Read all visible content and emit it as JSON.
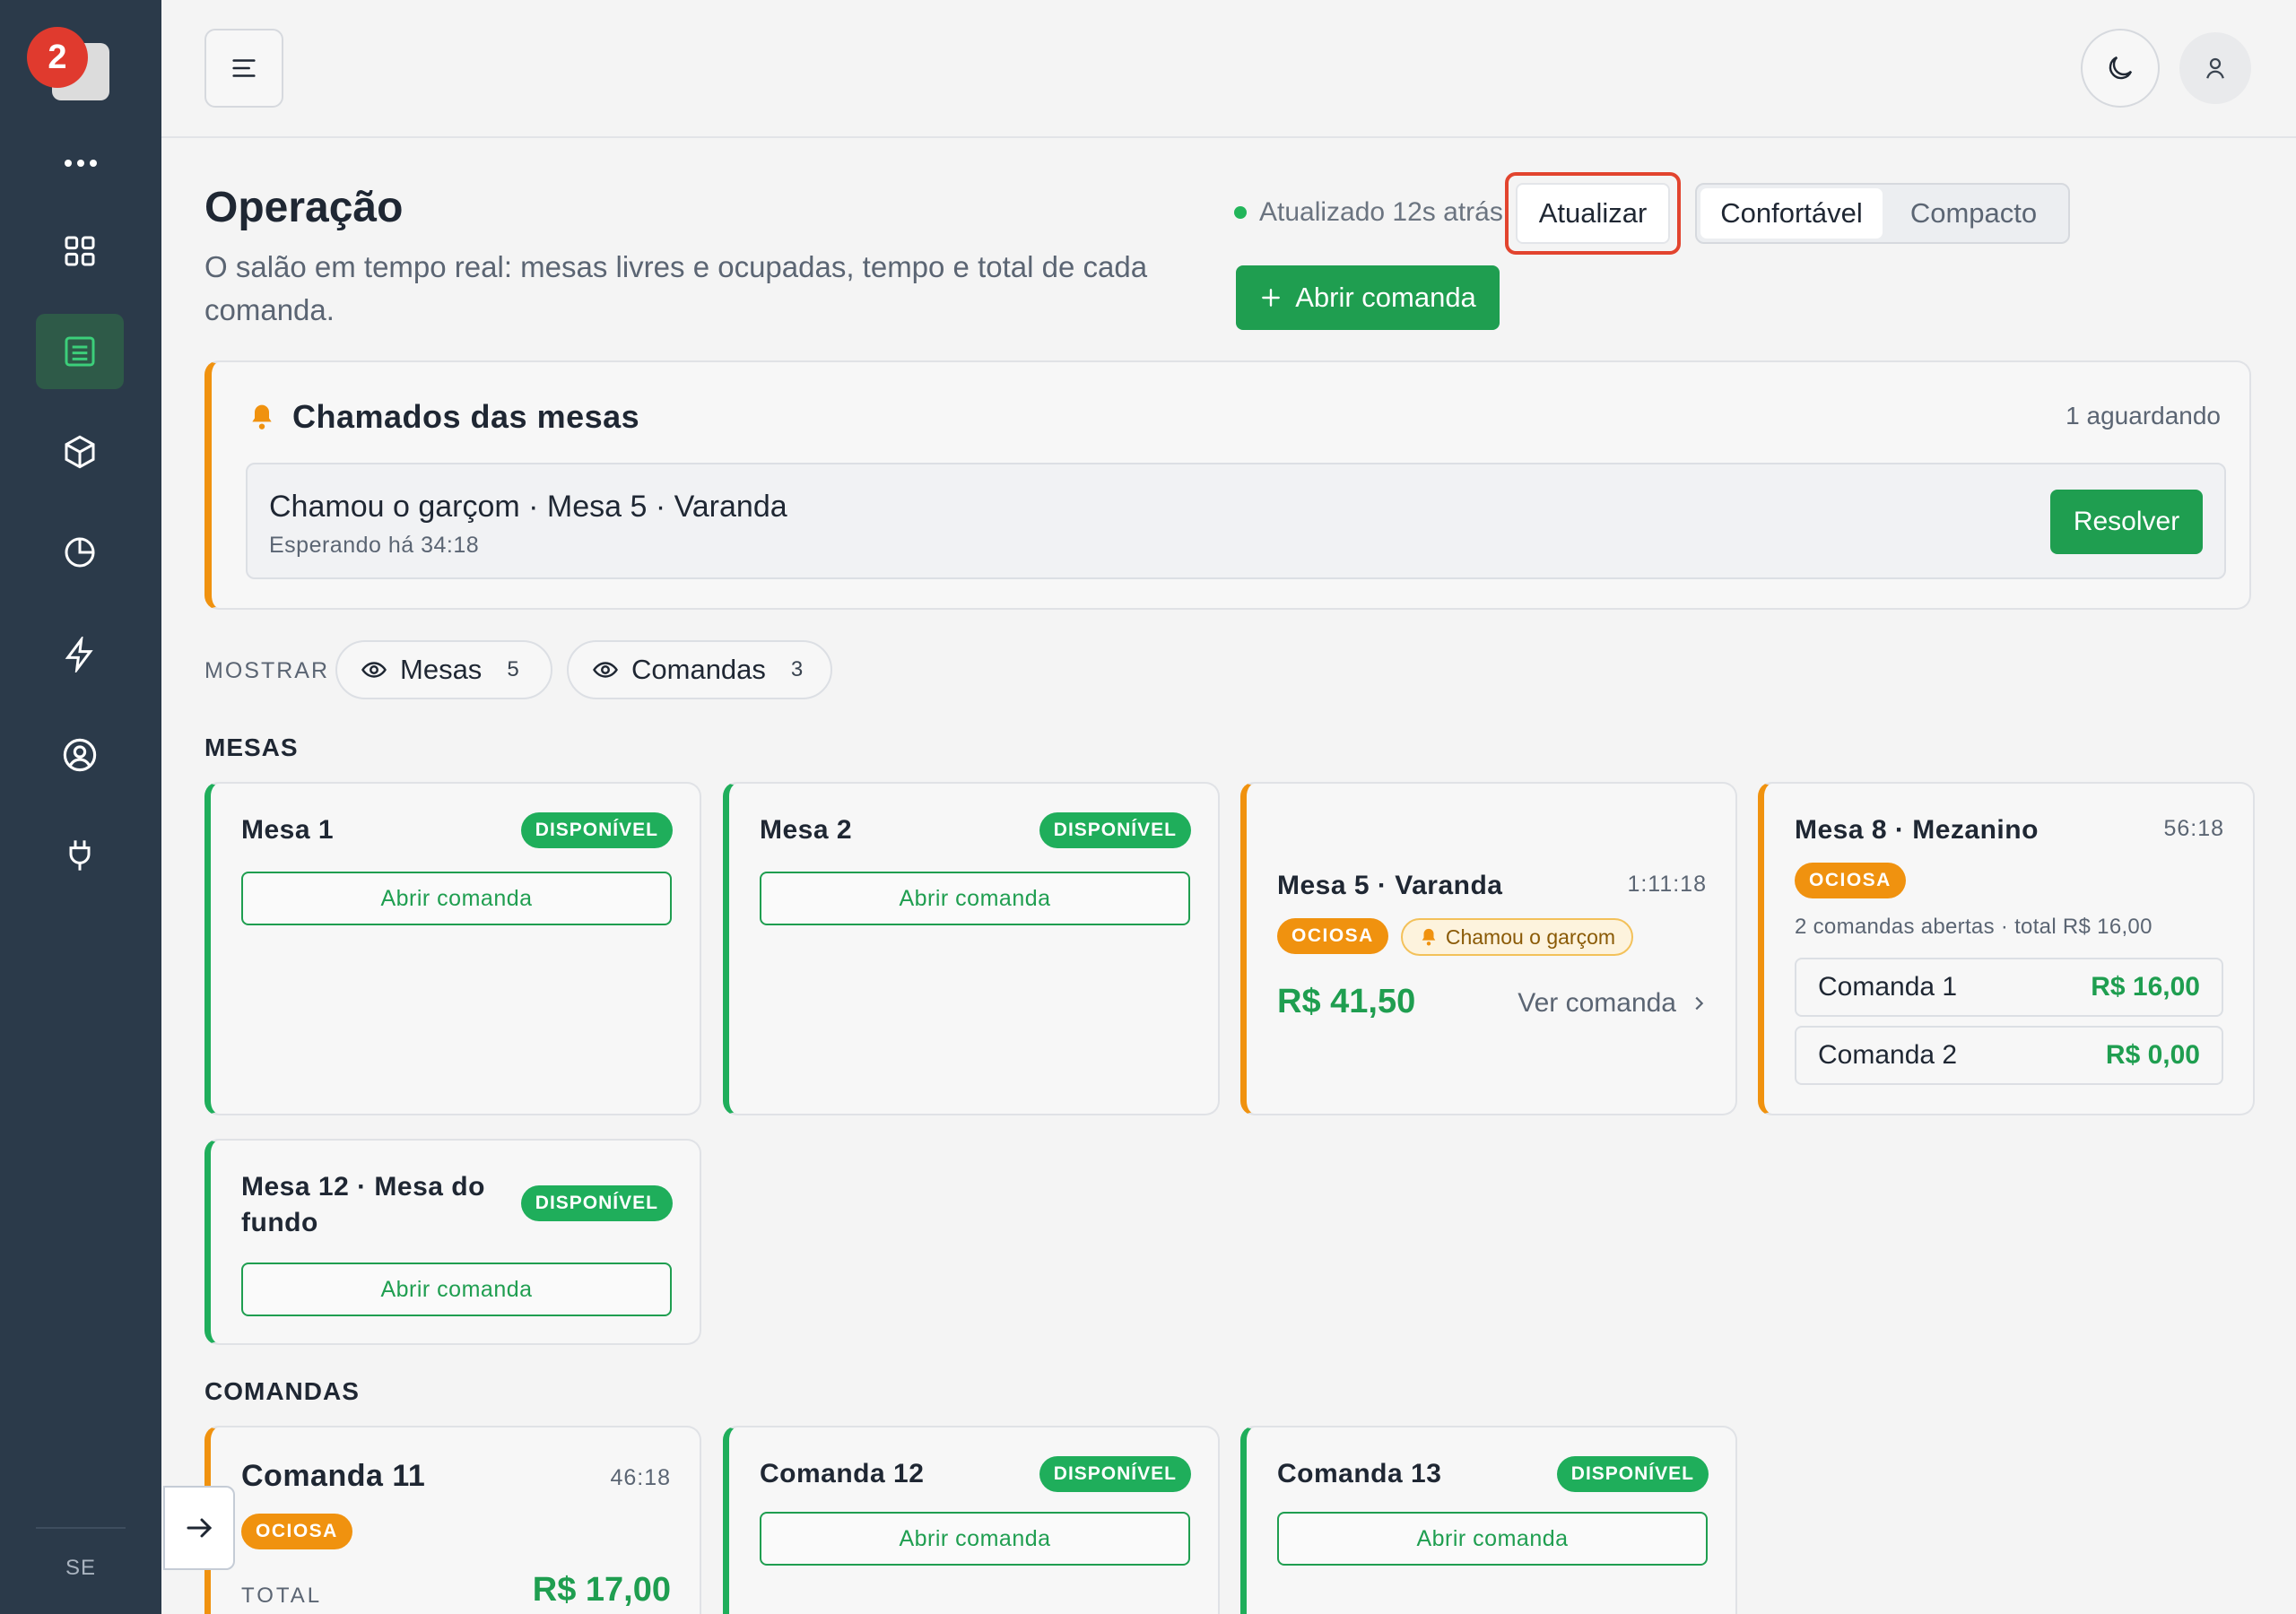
{
  "sidebar": {
    "badge_count": "2",
    "footer_label": "SE",
    "nav": [
      "dashboard-icon",
      "orders-icon",
      "box-icon",
      "pie-chart-icon",
      "bolt-icon",
      "user-circle-icon",
      "plug-icon"
    ],
    "active_color": "#2e5a48"
  },
  "header": {
    "title": "Operação",
    "subtitle": "O salão em tempo real: mesas livres e ocupadas, tempo e total de cada comanda.",
    "status": "Atualizado 12s atrás",
    "refresh_label": "Atualizar",
    "density": [
      "Confortável",
      "Compacto"
    ],
    "open_label": "Abrir comanda"
  },
  "calls": {
    "title": "Chamados das mesas",
    "count": "1 aguardando",
    "item_title": "Chamou o garçom · Mesa 5 · Varanda",
    "item_wait": "Esperando há 34:18",
    "resolve_label": "Resolver"
  },
  "filters": {
    "label": "MOSTRAR",
    "mesas_label": "Mesas",
    "mesas_count": "5",
    "comandas_label": "Comandas",
    "comandas_count": "3"
  },
  "mesas": {
    "title": "MESAS",
    "m1": {
      "name": "Mesa 1",
      "status": "DISPONÍVEL",
      "action": "Abrir comanda"
    },
    "m2": {
      "name": "Mesa 2",
      "status": "DISPONÍVEL",
      "action": "Abrir comanda"
    },
    "m5": {
      "name": "Mesa 5 · Varanda",
      "time": "1:11:18",
      "status": "OCIOSA",
      "call": "Chamou o garçom",
      "total": "R$ 41,50",
      "view": "Ver comanda"
    },
    "m8": {
      "name": "Mesa 8 · Mezanino",
      "time": "56:18",
      "status": "OCIOSA",
      "summary": "2 comandas abertas · total R$ 16,00",
      "rows": [
        {
          "label": "Comanda 1",
          "value": "R$ 16,00"
        },
        {
          "label": "Comanda 2",
          "value": "R$ 0,00"
        }
      ]
    },
    "m12": {
      "name": "Mesa 12 · Mesa do fundo",
      "status": "DISPONÍVEL",
      "action": "Abrir comanda"
    }
  },
  "comandas": {
    "title": "COMANDAS",
    "c11": {
      "name": "Comanda 11",
      "time": "46:18",
      "status": "OCIOSA",
      "total_label": "TOTAL",
      "total": "R$ 17,00"
    },
    "c12": {
      "name": "Comanda 12",
      "status": "DISPONÍVEL",
      "action": "Abrir comanda"
    },
    "c13": {
      "name": "Comanda 13",
      "status": "DISPONÍVEL",
      "action": "Abrir comanda"
    }
  },
  "colors": {
    "green": "#1f9e50",
    "orange": "#f0920f",
    "sidebar": "#2b3a4a",
    "highlight": "#e2442e"
  }
}
